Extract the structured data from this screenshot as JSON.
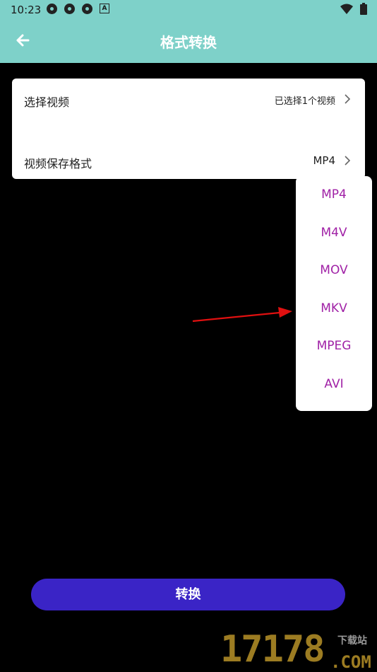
{
  "status_bar": {
    "time": "10:23"
  },
  "header": {
    "title": "格式转换"
  },
  "form": {
    "select_video_label": "选择视频",
    "select_video_value": "已选择1个视频",
    "format_label": "视频保存格式",
    "format_value": "MP4"
  },
  "format_options": [
    "MP4",
    "M4V",
    "MOV",
    "MKV",
    "MPEG",
    "AVI"
  ],
  "convert_button": "转换",
  "watermark": {
    "number": "17178",
    "suffix": ".COM",
    "tag": "下载站"
  },
  "colors": {
    "header_bg": "#7ed1c9",
    "option_text": "#a021a6",
    "button_bg": "#3a24c6",
    "annotation_arrow": "#e01010"
  }
}
